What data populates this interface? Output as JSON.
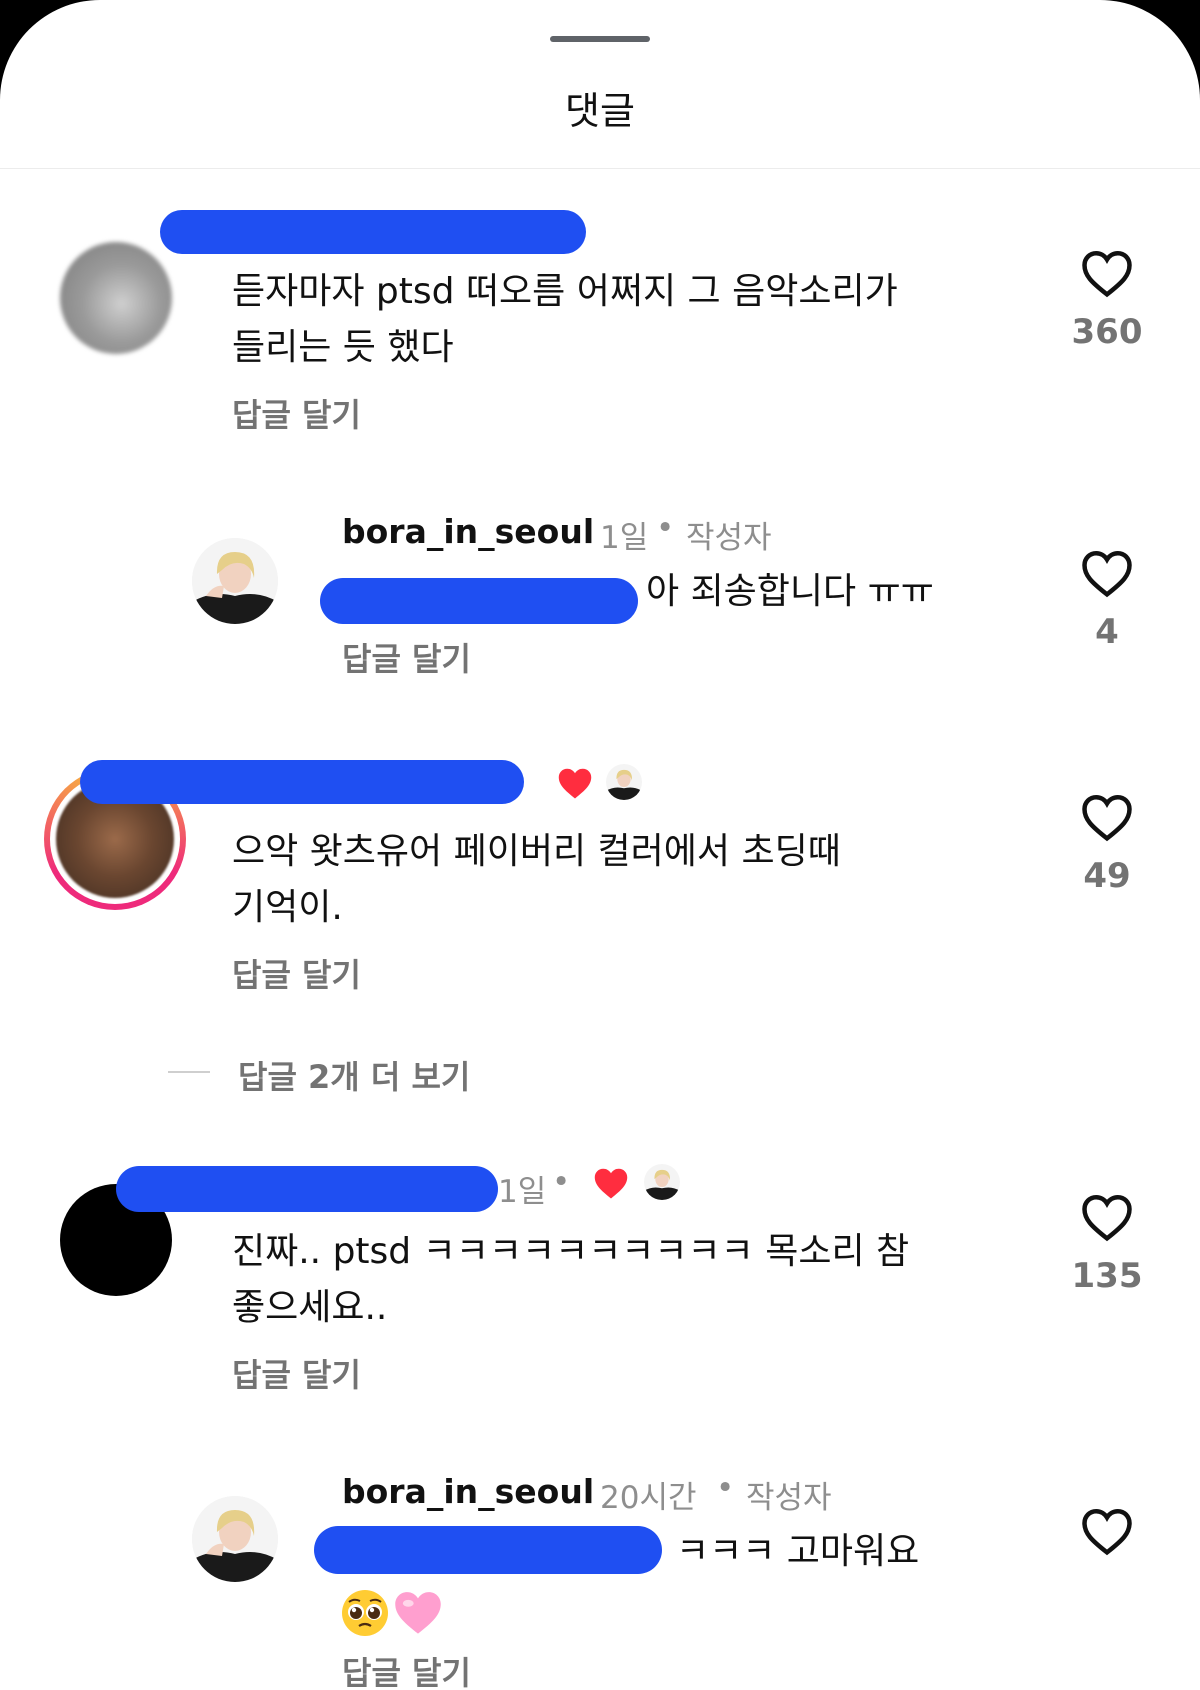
{
  "sheet": {
    "title": "댓글"
  },
  "comments": [
    {
      "body": "듣자마자 ptsd 떠오름 어쩌지 그 음악소리가\n들리는 듯 했다",
      "reply_label": "답글 달기",
      "likes": "360"
    },
    {
      "username": "bora_in_seoul",
      "time": "1일",
      "author_badge": "작성자",
      "body": "아 죄송합니다 ㅠㅠ",
      "reply_label": "답글 달기",
      "likes": "4"
    },
    {
      "body": "으악 왓츠유어 페이버리 컬러에서 초딩때\n기억이.",
      "reply_label": "답글 달기",
      "likes": "49"
    },
    {
      "time": "1일",
      "body": "진짜.. ptsd ㅋㅋㅋㅋㅋㅋㅋㅋㅋㅋ 목소리 참\n좋으세요..",
      "reply_label": "답글 달기",
      "likes": "135"
    },
    {
      "username": "bora_in_seoul",
      "time": "20시간",
      "author_badge": "작성자",
      "body": "ㅋㅋㅋ 고마워요",
      "reply_label": "답글 달기"
    }
  ],
  "view_more_replies": "답글 2개 더 보기",
  "separator": "•",
  "colors": {
    "like_heart": "#ff2d3f",
    "redaction": "#1f4ff2",
    "muted": "#737373"
  },
  "icons": {
    "like": "heart-outline-icon",
    "creator_like": "heart-filled-icon"
  }
}
